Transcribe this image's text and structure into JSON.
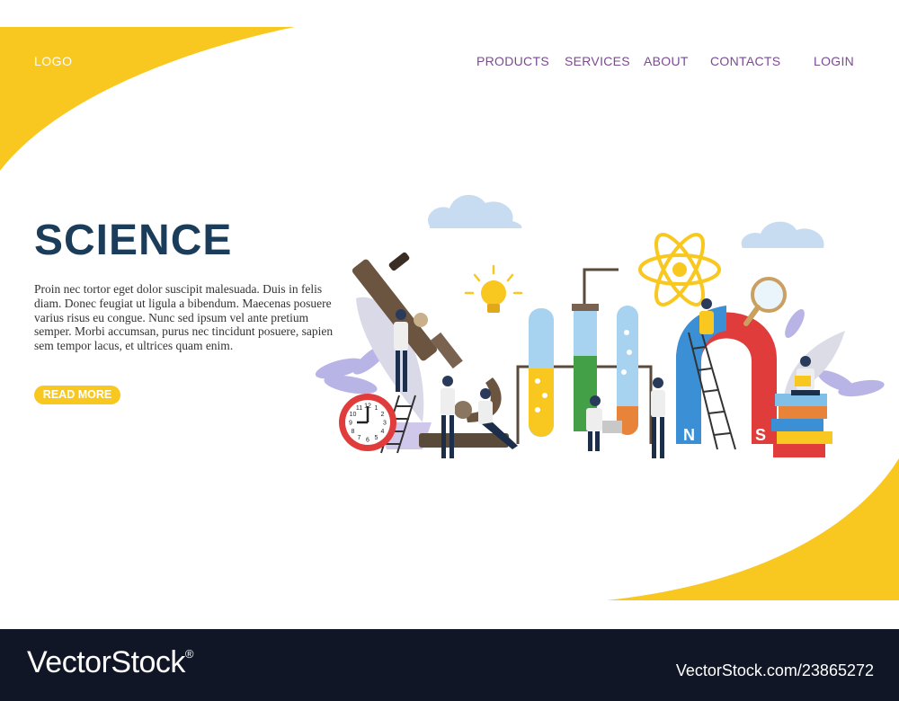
{
  "logo": "LOGO",
  "nav": {
    "products": "PRODUCTS",
    "services": "SERVICES",
    "about": "ABOUT",
    "contacts": "CONTACTS",
    "login": "LOGIN"
  },
  "hero": {
    "title": "SCIENCE",
    "text": "Proin nec tortor eget dolor suscipit malesuada. Duis in felis diam. Donec feugiat ut ligula a bibendum. Maecenas posuere varius risus eu congue. Nunc sed ipsum vel ante pretium semper. Morbi accumsan, purus nec tincidunt posuere, sapien sem tempor lacus, et ultrices quam enim.",
    "button": "READ MORE"
  },
  "illustration": {
    "magnet_north": "N",
    "magnet_south": "S",
    "clock_numbers": [
      "12",
      "1",
      "2",
      "3",
      "4",
      "5",
      "6",
      "7",
      "8",
      "9",
      "10",
      "11"
    ]
  },
  "watermark": {
    "brand": "VectorStock",
    "registered": "®",
    "id": "VectorStock.com/23865272"
  },
  "colors": {
    "accent_yellow": "#f9c820",
    "nav_purple": "#7b4a93",
    "title_navy": "#1c3d5a",
    "footer_bg": "#101626"
  }
}
